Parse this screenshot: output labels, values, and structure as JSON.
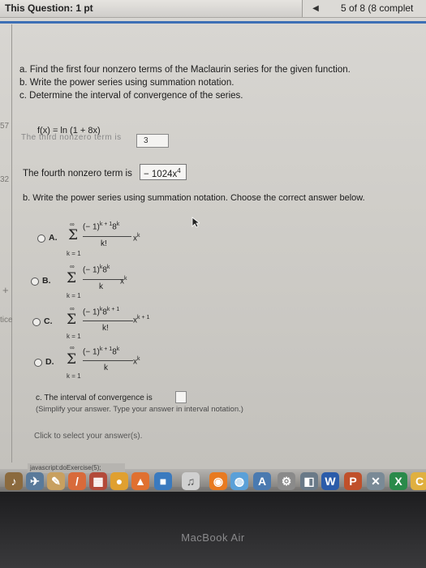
{
  "topbar": {
    "question_points": "This Question: 1 pt",
    "prev_glyph": "◀",
    "counter": "5 of 8 (8 complet"
  },
  "side_marks": {
    "m1": "57",
    "m2": "32",
    "m3": "+",
    "m4": "tice"
  },
  "instructions": [
    "a. Find the first four nonzero terms of the Maclaurin series for the given function.",
    "b. Write the power series using summation notation.",
    "c. Determine the interval of convergence of the series."
  ],
  "function": "f(x) = ln (1 + 8x)",
  "partial_text": "The third nonzero term is",
  "partial_answer": "3",
  "fourth_label": "The fourth nonzero term is",
  "fourth_answer": "− 1024x",
  "fourth_exp": "4",
  "part_b": "b. Write the power series using summation notation. Choose the correct answer below.",
  "options": [
    {
      "letter": "A.",
      "upper": "∞",
      "lower": "k = 1",
      "num": "(− 1)",
      "num_exp": "k + 1",
      "num_tail": "8",
      "num_tail_exp": "k",
      "den": "k!",
      "x": "x",
      "x_exp": "k"
    },
    {
      "letter": "B.",
      "upper": "∞",
      "lower": "k = 1",
      "num": "(− 1)",
      "num_exp": "k",
      "num_tail": "8",
      "num_tail_exp": "k",
      "den": "k",
      "x": "x",
      "x_exp": "k"
    },
    {
      "letter": "C.",
      "upper": "∞",
      "lower": "k = 1",
      "num": "(− 1)",
      "num_exp": "k",
      "num_tail": "8",
      "num_tail_exp": "k + 1",
      "den": "k!",
      "x": "x",
      "x_exp": "k + 1"
    },
    {
      "letter": "D.",
      "upper": "∞",
      "lower": "k = 1",
      "num": "(− 1)",
      "num_exp": "k + 1",
      "num_tail": "8",
      "num_tail_exp": "k",
      "den": "k",
      "x": "x",
      "x_exp": "k"
    }
  ],
  "part_c": "c. The interval of convergence is",
  "hint": "(Simplify your answer. Type your answer in interval notation.)",
  "select_link": "Click to select your answer(s).",
  "status_bar": "javascript:doExercise(5);",
  "brand": "MacBook Air"
}
